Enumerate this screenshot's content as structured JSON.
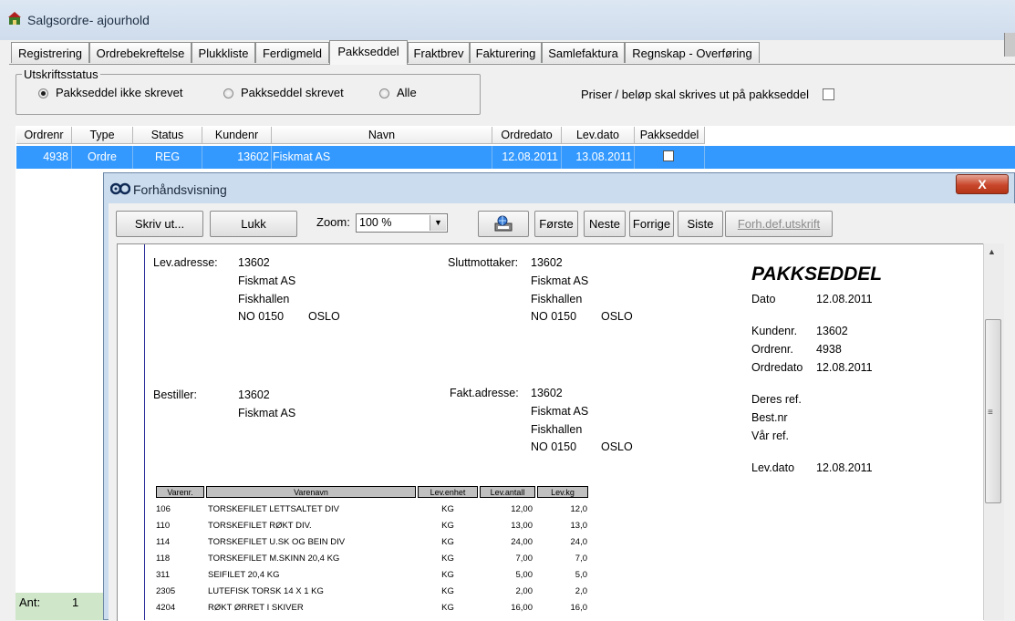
{
  "window": {
    "title": "Salgsordre- ajourhold"
  },
  "tabs": [
    "Registrering",
    "Ordrebekreftelse",
    "Plukkliste",
    "Ferdigmeld",
    "Pakkseddel",
    "Fraktbrev",
    "Fakturering",
    "Samlefaktura",
    "Regnskap - Overføring"
  ],
  "active_tab": "Pakkseddel",
  "status_group": {
    "legend": "Utskriftsstatus",
    "options": [
      "Pakkseddel ikke skrevet",
      "Pakkseddel skrevet",
      "Alle"
    ],
    "selected": "Pakkseddel ikke skrevet"
  },
  "prices_checkbox": {
    "label": "Priser / beløp skal skrives ut på pakkseddel",
    "checked": false
  },
  "grid": {
    "columns": [
      "Ordrenr",
      "Type",
      "Status",
      "Kundenr",
      "Navn",
      "Ordredato",
      "Lev.dato",
      "Pakkseddel"
    ],
    "rows": [
      {
        "ordrenr": "4938",
        "type": "Ordre",
        "status": "REG",
        "kundenr": "13602",
        "navn": "Fiskmat AS",
        "ordredato": "12.08.2011",
        "levdato": "13.08.2011",
        "pakkseddel": false
      }
    ]
  },
  "footer": {
    "ant_label": "Ant:",
    "ant_value": "1"
  },
  "preview": {
    "title": "Forhåndsvisning",
    "buttons": {
      "print": "Skriv ut...",
      "close": "Lukk",
      "first": "Første",
      "next": "Neste",
      "prev": "Forrige",
      "last": "Siste",
      "pagedef": "Forh.def.utskrift"
    },
    "zoom_label": "Zoom:",
    "zoom_value": "100 %",
    "close_glyph": "X",
    "doc": {
      "title": "PAKKSEDDEL",
      "lev_adresse": {
        "label": "Lev.adresse:",
        "lines": [
          "13602",
          "Fiskmat AS",
          "Fiskhallen"
        ],
        "postnr": "NO 0150",
        "sted": "OSLO"
      },
      "sluttmottaker": {
        "label": "Sluttmottaker:",
        "lines": [
          "13602",
          "Fiskmat AS",
          "Fiskhallen"
        ],
        "postnr": "NO 0150",
        "sted": "OSLO"
      },
      "bestiller": {
        "label": "Bestiller:",
        "lines": [
          "13602",
          "Fiskmat AS"
        ]
      },
      "fakt_adresse": {
        "label": "Fakt.adresse:",
        "lines": [
          "13602",
          "Fiskmat AS",
          "Fiskhallen"
        ],
        "postnr": "NO 0150",
        "sted": "OSLO"
      },
      "info": {
        "dato_label": "Dato",
        "dato": "12.08.2011",
        "kundenr_label": "Kundenr.",
        "kundenr": "13602",
        "ordrenr_label": "Ordrenr.",
        "ordrenr": "4938",
        "ordredato_label": "Ordredato",
        "ordredato": "12.08.2011",
        "deres_ref_label": "Deres ref.",
        "bestnr_label": "Best.nr",
        "var_ref_label": "Vår ref.",
        "levdato_label": "Lev.dato",
        "levdato": "12.08.2011"
      },
      "lines_header": [
        "Varenr.",
        "Varenavn",
        "Lev.enhet",
        "Lev.antall",
        "Lev.kg"
      ],
      "lines": [
        {
          "varenr": "106",
          "varenavn": "TORSKEFILET LETTSALTET DIV",
          "enhet": "KG",
          "antall": "12,00",
          "kg": "12,0"
        },
        {
          "varenr": "110",
          "varenavn": "TORSKEFILET RØKT DIV.",
          "enhet": "KG",
          "antall": "13,00",
          "kg": "13,0"
        },
        {
          "varenr": "114",
          "varenavn": "TORSKEFILET U.SK OG BEIN DIV",
          "enhet": "KG",
          "antall": "24,00",
          "kg": "24,0"
        },
        {
          "varenr": "118",
          "varenavn": "TORSKEFILET M.SKINN 20,4 KG",
          "enhet": "KG",
          "antall": "7,00",
          "kg": "7,0"
        },
        {
          "varenr": "311",
          "varenavn": "SEIFILET 20,4 KG",
          "enhet": "KG",
          "antall": "5,00",
          "kg": "5,0"
        },
        {
          "varenr": "2305",
          "varenavn": "LUTEFISK TORSK 14 X 1 KG",
          "enhet": "KG",
          "antall": "2,00",
          "kg": "2,0"
        },
        {
          "varenr": "4204",
          "varenavn": "RØKT ØRRET I SKIVER",
          "enhet": "KG",
          "antall": "16,00",
          "kg": "16,0"
        }
      ]
    }
  }
}
